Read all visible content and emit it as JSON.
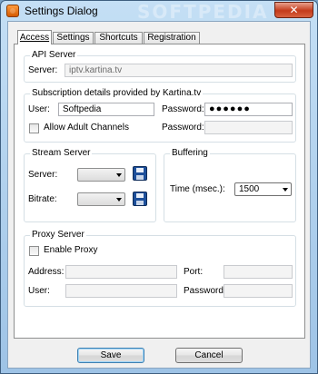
{
  "window": {
    "title": "Settings Dialog",
    "watermark": "SOFTPEDIA",
    "close_label": "✕"
  },
  "tabs": [
    {
      "label": "Access",
      "active": true
    },
    {
      "label": "Settings",
      "active": false
    },
    {
      "label": "Shortcuts",
      "active": false
    },
    {
      "label": "Registration",
      "active": false
    }
  ],
  "api_server": {
    "group_label": "API Server",
    "server_label": "Server:",
    "server_value": "iptv.kartina.tv"
  },
  "subscription": {
    "group_label": "Subscription details provided by Kartina.tv",
    "user_label": "User:",
    "user_value": "Softpedia",
    "password_label": "Password:",
    "password_value": "●●●●●●",
    "allow_adult_label": "Allow Adult Channels",
    "adult_password_label": "Password:",
    "adult_password_value": ""
  },
  "stream_server": {
    "group_label": "Stream Server",
    "server_label": "Server:",
    "bitrate_label": "Bitrate:"
  },
  "buffering": {
    "group_label": "Buffering",
    "time_label": "Time (msec.):",
    "time_value": "1500"
  },
  "proxy": {
    "group_label": "Proxy Server",
    "enable_label": "Enable Proxy",
    "address_label": "Address:",
    "port_label": "Port:",
    "user_label": "User:",
    "password_label": "Password:"
  },
  "buttons": {
    "save_label": "Save",
    "cancel_label": "Cancel"
  }
}
